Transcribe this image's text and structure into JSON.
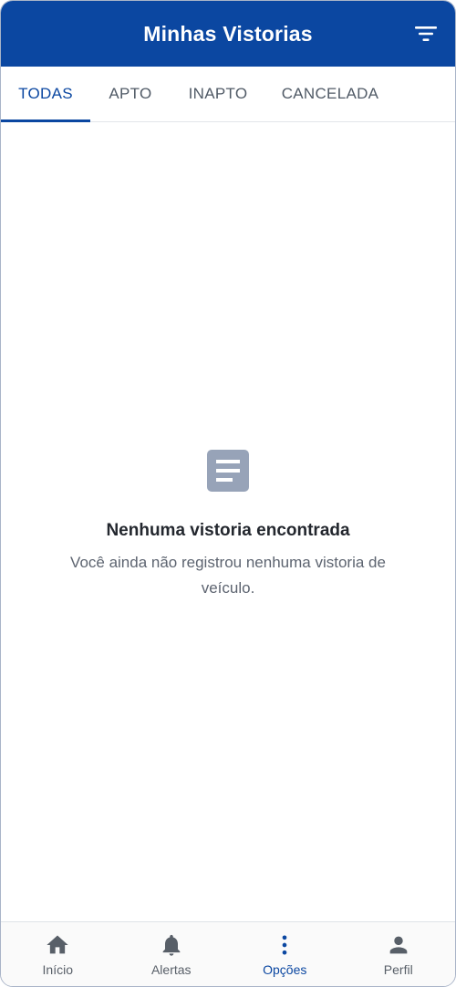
{
  "header": {
    "title": "Minhas Vistorias",
    "filter_icon": "filter-list-icon"
  },
  "tabs": [
    {
      "label": "TODAS",
      "active": true
    },
    {
      "label": "APTO",
      "active": false
    },
    {
      "label": "INAPTO",
      "active": false
    },
    {
      "label": "CANCELADA",
      "active": false
    }
  ],
  "empty_state": {
    "icon": "document-lines-icon",
    "title": "Nenhuma vistoria encontrada",
    "message": "Você ainda não registrou nenhuma vistoria de veículo."
  },
  "bottom_nav": [
    {
      "label": "Início",
      "icon": "home-icon",
      "active": false
    },
    {
      "label": "Alertas",
      "icon": "bell-icon",
      "active": false
    },
    {
      "label": "Opções",
      "icon": "more-vertical-icon",
      "active": true
    },
    {
      "label": "Perfil",
      "icon": "person-icon",
      "active": false
    }
  ],
  "colors": {
    "primary": "#0b47a1",
    "empty_icon": "#97a3b8",
    "nav_inactive": "#585f68"
  }
}
